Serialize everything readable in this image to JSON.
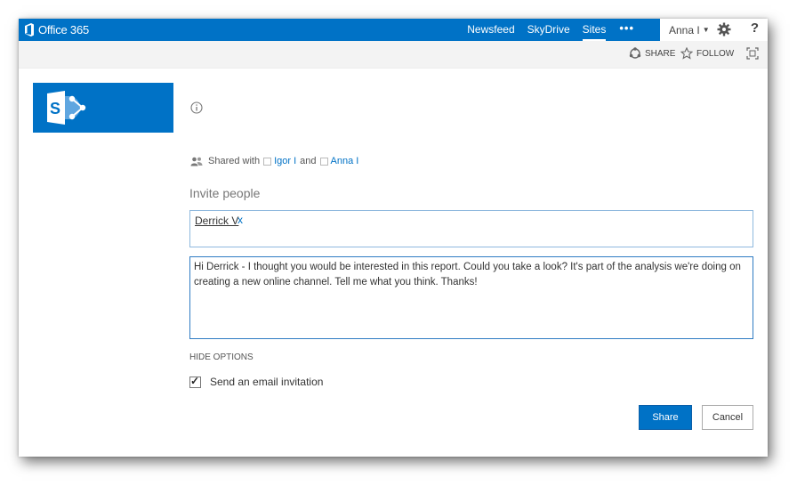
{
  "suite_bar": {
    "brand": "Office 365",
    "nav": [
      {
        "label": "Newsfeed",
        "active": false
      },
      {
        "label": "SkyDrive",
        "active": false
      },
      {
        "label": "Sites",
        "active": true
      }
    ],
    "more_label": "•••",
    "user_name": "Anna I",
    "help_label": "?",
    "brand_color": "#0072c6"
  },
  "ribbon": {
    "share_label": "SHARE",
    "follow_label": "FOLLOW"
  },
  "site": {
    "logo_letter": "S"
  },
  "share_panel": {
    "shared_with_prefix": "Shared with",
    "shared_users": [
      "Igor I",
      "Anna I"
    ],
    "conjunction": "and",
    "invite_title": "Invite people",
    "invited_person": "Derrick V",
    "remove_label": "x",
    "message": "Hi Derrick - I thought you would be interested in this report. Could you take a look? It's part of the analysis we're doing on creating a new online channel. Tell me what you think. Thanks!",
    "hide_options_label": "HIDE OPTIONS",
    "send_email_label": "Send an email invitation",
    "send_email_checked": true,
    "share_button": "Share",
    "cancel_button": "Cancel"
  }
}
